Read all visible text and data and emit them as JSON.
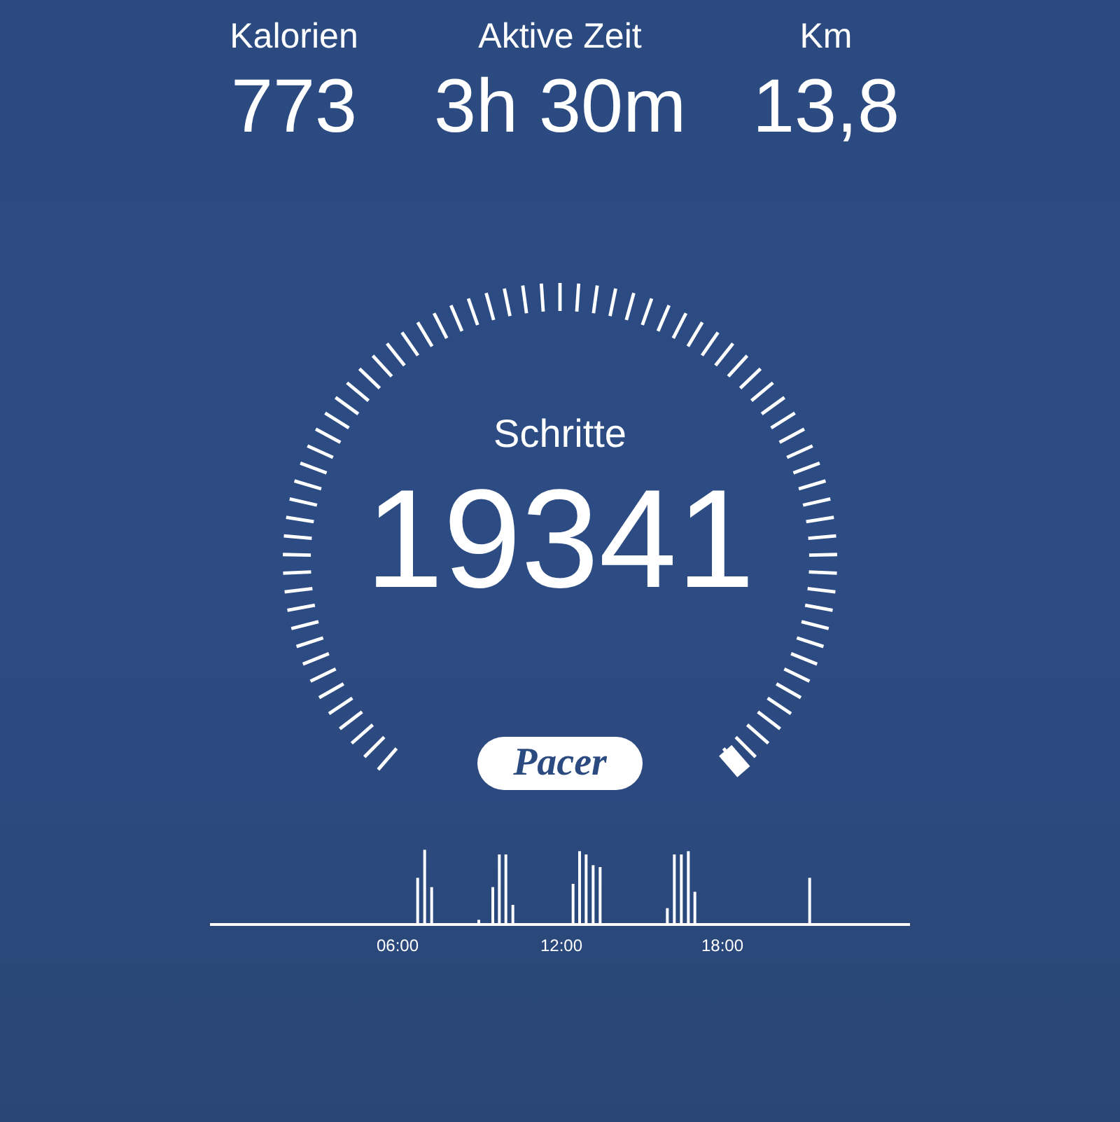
{
  "stats": [
    {
      "label": "Kalorien",
      "value": "773"
    },
    {
      "label": "Aktive Zeit",
      "value": "3h 30m"
    },
    {
      "label": "Km",
      "value": "13,8"
    }
  ],
  "steps": {
    "label": "Schritte",
    "value": "19341"
  },
  "brand": "Pacer",
  "activity": {
    "ticks": [
      "06:00",
      "12:00",
      "18:00"
    ]
  }
}
